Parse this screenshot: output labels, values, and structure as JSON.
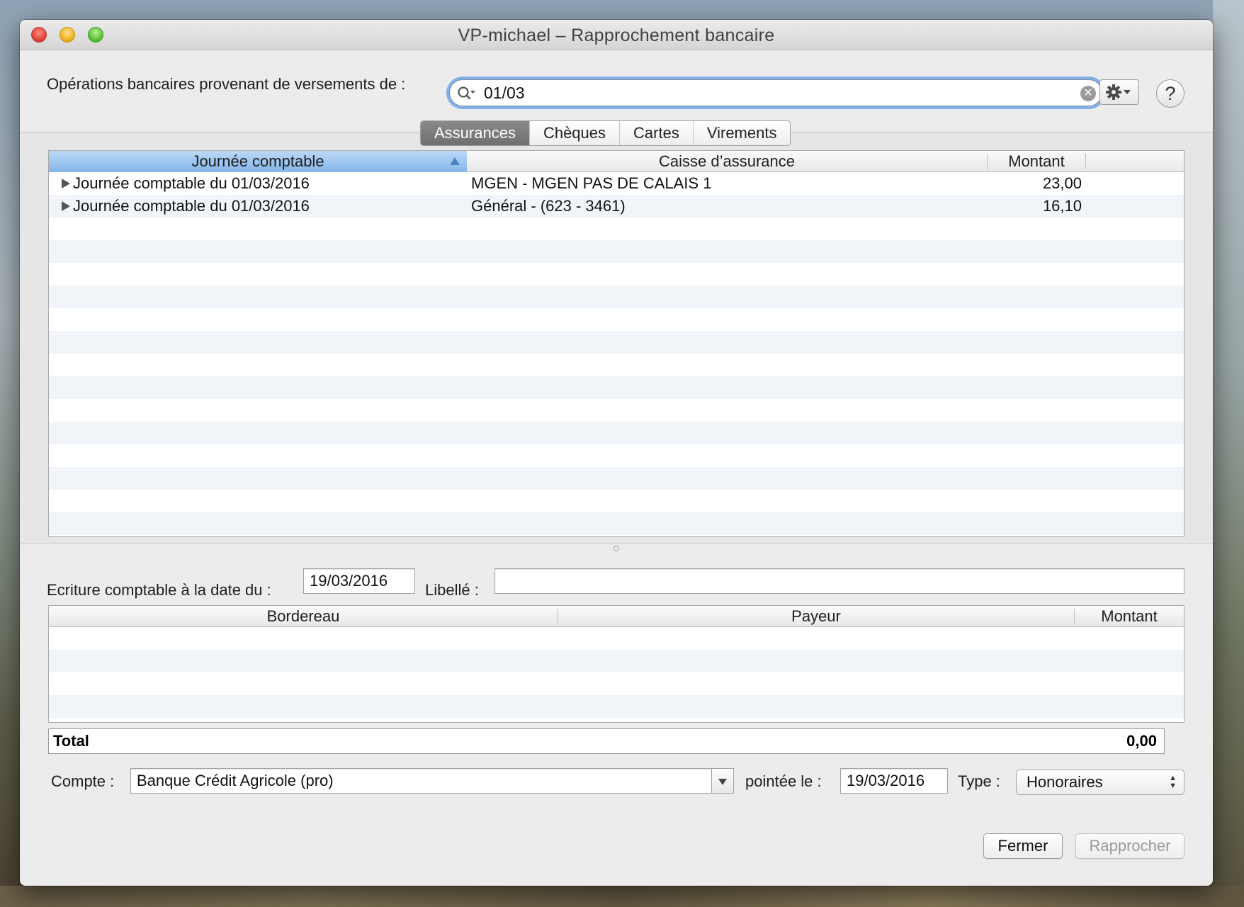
{
  "window": {
    "title": "VP-michael – Rapprochement bancaire"
  },
  "search": {
    "label": "Opérations bancaires provenant de versements de :",
    "value": "01/03"
  },
  "toolbar": {
    "help_label": "?"
  },
  "tabs": [
    {
      "label": "Assurances",
      "active": true
    },
    {
      "label": "Chèques",
      "active": false
    },
    {
      "label": "Cartes",
      "active": false
    },
    {
      "label": "Virements",
      "active": false
    }
  ],
  "operations_table": {
    "columns": [
      "Journée comptable",
      "Caisse d’assurance",
      "Montant"
    ],
    "sort_column": "Journée comptable",
    "rows": [
      {
        "journee": "Journée comptable du 01/03/2016",
        "caisse": "MGEN - MGEN PAS DE CALAIS 1",
        "montant": "23,00"
      },
      {
        "journee": "Journée comptable du 01/03/2016",
        "caisse": "Général - (623 - 3461)",
        "montant": "16,10"
      }
    ]
  },
  "ecriture": {
    "date_label": "Ecriture comptable à la date du :",
    "date_value": "19/03/2016",
    "libelle_label": "Libellé :",
    "libelle_value": ""
  },
  "bordereau_table": {
    "columns": [
      "Bordereau",
      "Payeur",
      "Montant"
    ],
    "rows": []
  },
  "total": {
    "label": "Total",
    "value": "0,00"
  },
  "compte": {
    "label": "Compte :",
    "value": "Banque Crédit Agricole (pro)",
    "pointee_label": "pointée le :",
    "pointee_value": "19/03/2016",
    "type_label": "Type :",
    "type_value": "Honoraires"
  },
  "buttons": {
    "fermer": "Fermer",
    "rapprocher": "Rapprocher"
  },
  "colors": {
    "focus_ring": "#7fb0ec",
    "sorted_header": "#84b5ea",
    "active_tab": "#7a7a7a"
  }
}
